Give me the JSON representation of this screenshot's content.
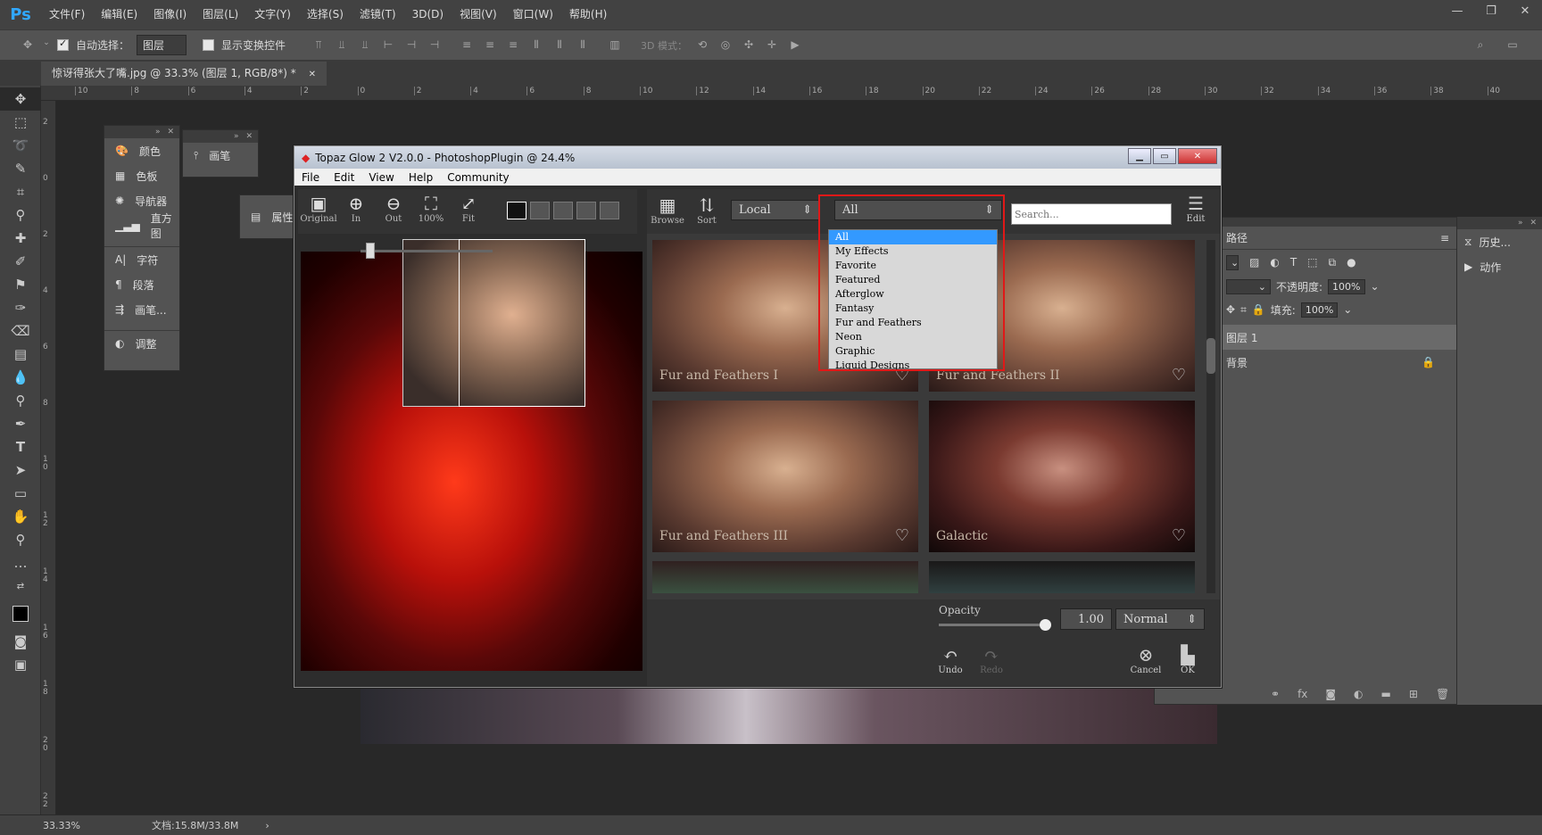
{
  "app": {
    "logo": "Ps"
  },
  "menubar": {
    "items": [
      "文件(F)",
      "编辑(E)",
      "图像(I)",
      "图层(L)",
      "文字(Y)",
      "选择(S)",
      "滤镜(T)",
      "3D(D)",
      "视图(V)",
      "窗口(W)",
      "帮助(H)"
    ]
  },
  "options": {
    "auto_select_label": "自动选择：",
    "auto_select_value": "图层",
    "show_transform": "显示变换控件",
    "mode3d": "3D 模式："
  },
  "document": {
    "tab_title": "惊讶得张大了嘴.jpg @ 33.3% (图层 1, RGB/8*) *"
  },
  "ruler_ticks": [
    "10",
    "8",
    "6",
    "4",
    "2",
    "0",
    "2",
    "4",
    "6",
    "8",
    "10",
    "12",
    "14",
    "16",
    "18",
    "20",
    "22",
    "24",
    "26",
    "28",
    "30",
    "32",
    "34",
    "36",
    "38",
    "40"
  ],
  "ruler_left_ticks": [
    "2",
    "0",
    "2",
    "4",
    "6",
    "8",
    "1\n0",
    "1\n2",
    "1\n4",
    "1\n6",
    "1\n8",
    "2\n0",
    "2\n2"
  ],
  "left_panels": {
    "group1": [
      "颜色",
      "色板",
      "导航器",
      "直方图"
    ],
    "group2": [
      "字符",
      "段落",
      "画笔..."
    ],
    "group3": [
      "调整"
    ],
    "brush": "画笔",
    "props": "属性"
  },
  "layers": {
    "tab_path": "路径",
    "opacity_label": "不透明度:",
    "opacity_value": "100%",
    "fill_label": "填充:",
    "fill_value": "100%",
    "layer1": "图层 1",
    "background": "背景"
  },
  "history": {
    "hist": "历史...",
    "actions": "动作"
  },
  "status": {
    "zoom": "33.33%",
    "doc": "文档:15.8M/33.8M"
  },
  "dialog": {
    "title": "Topaz Glow 2 V2.0.0 - PhotoshopPlugin @ 24.4%",
    "menu": [
      "File",
      "Edit",
      "View",
      "Help",
      "Community"
    ],
    "view_tools": [
      {
        "g": "▣",
        "l": "Original"
      },
      {
        "g": "⊕",
        "l": "In"
      },
      {
        "g": "⊖",
        "l": "Out"
      },
      {
        "g": "⛶",
        "l": "100%"
      },
      {
        "g": "⤢",
        "l": "Fit"
      }
    ],
    "browse": "Browse",
    "sort": "Sort",
    "source": "Local",
    "category": "All",
    "search_placeholder": "Search...",
    "edit": "Edit",
    "dropdown_items": [
      "All",
      "My Effects",
      "Favorite",
      "Featured",
      "Afterglow",
      "Fantasy",
      "Fur and Feathers",
      "Neon",
      "Graphic",
      "Liquid Designs"
    ],
    "thumbs": [
      "Fur and Feathers I",
      "Fur and Feathers II",
      "Fur and Feathers III",
      "Galactic"
    ],
    "opacity_label": "Opacity",
    "opacity_value": "1.00",
    "opacity_fraction": 1.0,
    "blend": "Normal",
    "undo": "Undo",
    "redo": "Redo",
    "cancel": "Cancel",
    "ok": "OK"
  },
  "colors": {
    "accent_blue": "#3399ff",
    "highlight_red": "#e01818"
  }
}
